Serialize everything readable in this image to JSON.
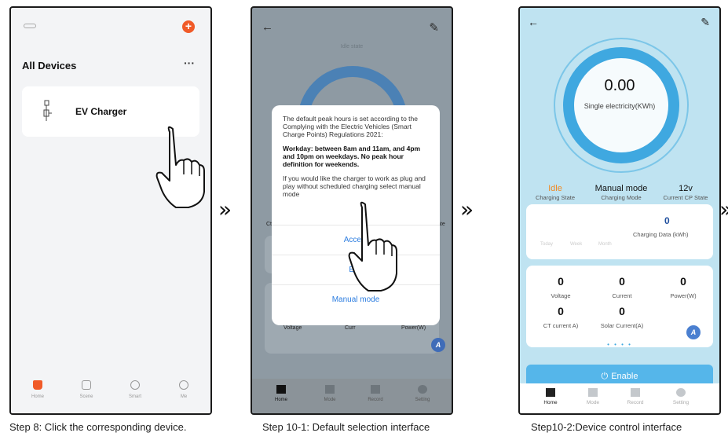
{
  "captions": {
    "step8": "Step 8: Click the corresponding device.",
    "step10_1": "Step 10-1: Default selection interface",
    "step10_2": "Step10-2:Device control interface"
  },
  "separator": "»",
  "phone1": {
    "title": "All Devices",
    "more": "···",
    "add": "+",
    "device_name": "EV Charger",
    "tabs": [
      "Home",
      "Scene",
      "Smart",
      "Me"
    ]
  },
  "phone2": {
    "back": "←",
    "edit": "✎",
    "faint_header": "Idle state",
    "dialog": {
      "p1": "The default peak hours is set according to the Complying with the Electric Vehicles (Smart Charge Points) Regulations 2021:",
      "p2": "Workday: between 8am and 11am, and 4pm and 10pm on weekdays. No peak hour definition for weekends.",
      "p3": "If you would like the charger to work as plug and play without scheduled charging select manual mode",
      "accept": "Accept",
      "edit": "Edit",
      "manual": "Manual mode"
    },
    "bg_left": "Ct",
    "bg_right": "ate",
    "bg_voltage": "Voltage",
    "bg_current": "Curr",
    "bg_power": "Power(W)",
    "badge": "A",
    "tabs": [
      "Home",
      "Mode",
      "Record",
      "Setting"
    ]
  },
  "phone3": {
    "back": "←",
    "edit": "✎",
    "ring_value": "0.00",
    "ring_label": "Single electricity(KWh)",
    "stats": [
      {
        "value": "Idle",
        "label": "Charging State"
      },
      {
        "value": "Manual mode",
        "label": "Charging Mode"
      },
      {
        "value": "12v",
        "label": "Current CP State"
      }
    ],
    "charging_data_value": "0",
    "charging_data_label": "Charging Data (kWh)",
    "faint_days": [
      "Today",
      "Week",
      "Month"
    ],
    "metrics": [
      {
        "value": "0",
        "label": "Voltage"
      },
      {
        "value": "0",
        "label": "Current"
      },
      {
        "value": "0",
        "label": "Power(W)"
      },
      {
        "value": "0",
        "label": "CT current A)"
      },
      {
        "value": "0",
        "label": "Solar Current(A)"
      }
    ],
    "dots": "• • • •",
    "badge": "A",
    "enable_label": "Enable",
    "enable_icon": "⏻",
    "tabs": [
      "Home",
      "Mode",
      "Record",
      "Setting"
    ]
  },
  "colors": {
    "accent_orange": "#f05a28",
    "blue": "#3fa8e0",
    "link_blue": "#2c7de0"
  }
}
